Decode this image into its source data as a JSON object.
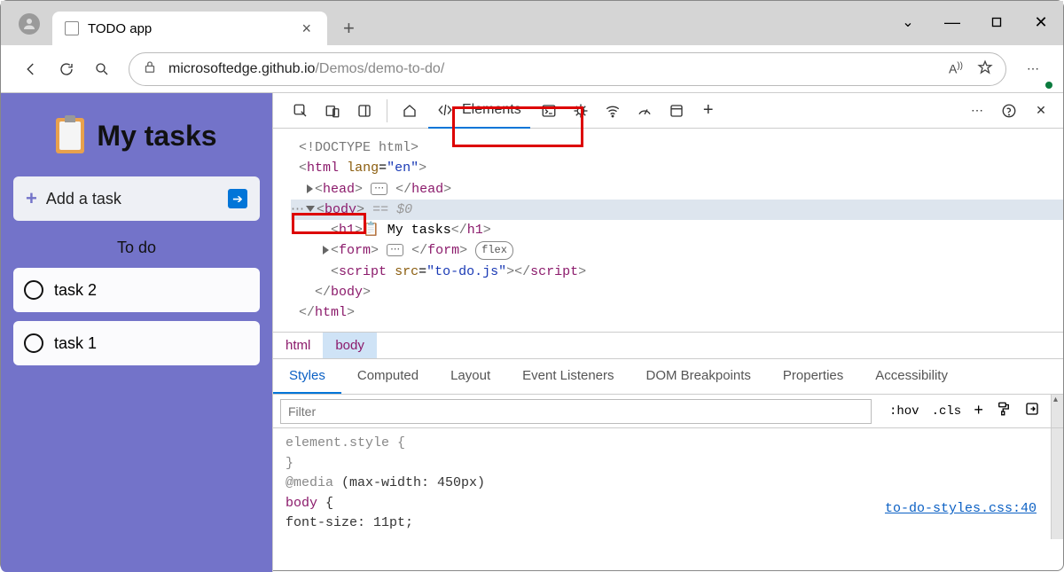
{
  "tab": {
    "title": "TODO app"
  },
  "url": {
    "domain": "microsoftedge.github.io",
    "path": "/Demos/demo-to-do/"
  },
  "app": {
    "title": "My tasks",
    "add_placeholder": "Add a task",
    "section": "To do",
    "tasks": [
      "task 2",
      "task 1"
    ]
  },
  "devtools": {
    "tabs": {
      "elements": "Elements"
    },
    "dom": {
      "doctype": "<!DOCTYPE html>",
      "html_open": "html",
      "lang_attr": "lang",
      "lang_val": "\"en\"",
      "head": "head",
      "body": "body",
      "eq_dollar": "== $0",
      "h1": "h1",
      "h1_text": " My tasks",
      "form": "form",
      "flex": "flex",
      "script": "script",
      "src_attr": "src",
      "src_val": "\"to-do.js\""
    },
    "breadcrumbs": [
      "html",
      "body"
    ],
    "styles_tabs": [
      "Styles",
      "Computed",
      "Layout",
      "Event Listeners",
      "DOM Breakpoints",
      "Properties",
      "Accessibility"
    ],
    "filter_placeholder": "Filter",
    "filter_btns": {
      "hov": ":hov",
      "cls": ".cls"
    },
    "styles": {
      "element_style": "element.style {",
      "close": "}",
      "media": "@media (max-width: 450px)",
      "body_sel": "body {",
      "font_size": "  font-size: 11pt;",
      "link": "to-do-styles.css:40"
    }
  }
}
